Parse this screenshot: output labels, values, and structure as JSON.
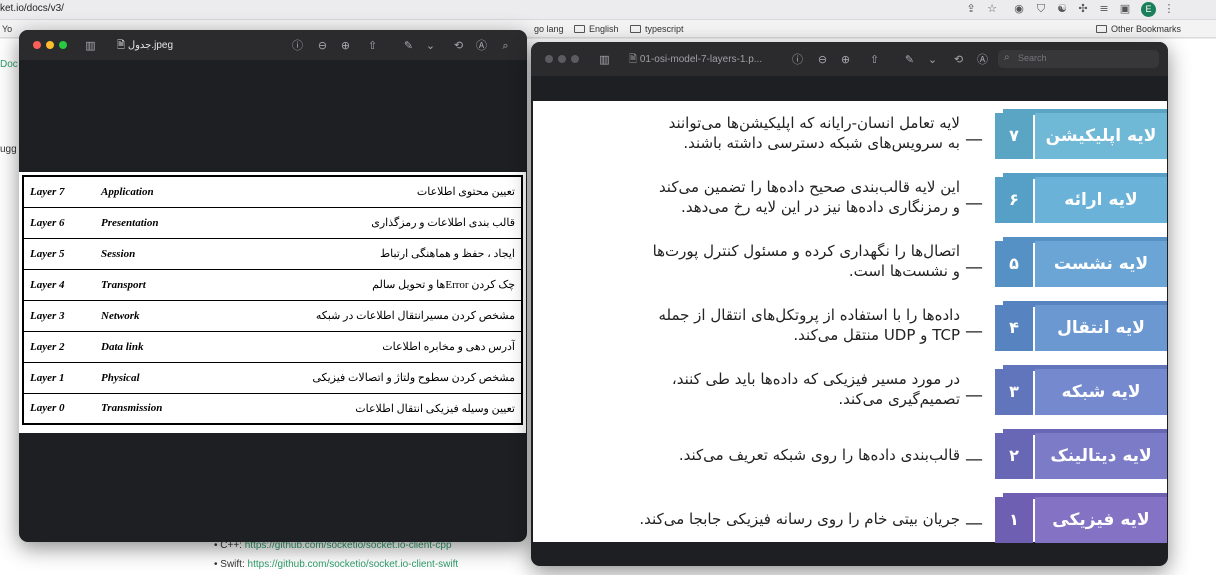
{
  "browser": {
    "url": "ket.io/docs/v3/",
    "avatar": "E"
  },
  "bookmarks": [
    "Yo",
    "go lang",
    "English",
    "typescript",
    "Other Bookmarks"
  ],
  "page": {
    "side_doc": "Doc",
    "side_sug": "ugg",
    "link1_label": "C++:",
    "link1": "https://github.com/socketio/socket.io-client-cpp",
    "link2_label": "Swift:",
    "link2": "https://github.com/socketio/socket.io-client-swift"
  },
  "window_left": {
    "title": "جدول‌.jpeg"
  },
  "window_right": {
    "title": "01-osi-model-7-layers-1.p...",
    "search_placeholder": "Search"
  },
  "table": [
    {
      "layer": "Layer 7",
      "name": "Application",
      "desc": "تعیین محتوی اطلاعات"
    },
    {
      "layer": "Layer 6",
      "name": "Presentation",
      "desc": "قالب بندی اطلاعات و رمزگذاری"
    },
    {
      "layer": "Layer 5",
      "name": "Session",
      "desc": "ایجاد ، حفظ و هماهنگی ارتباط"
    },
    {
      "layer": "Layer 4",
      "name": "Transport",
      "desc": "چک کردن Errorها و تحویل سالم"
    },
    {
      "layer": "Layer 3",
      "name": "Network",
      "desc": "مشخص کردن مسیرانتقال اطلاعات در شبکه"
    },
    {
      "layer": "Layer 2",
      "name": "Data link",
      "desc": "آدرس دهی و مخابره اطلاعات"
    },
    {
      "layer": "Layer 1",
      "name": "Physical",
      "desc": "مشخص کردن سطوح ولتاژ و اتصالات فیزیکی"
    },
    {
      "layer": "Layer 0",
      "name": "Transmission",
      "desc": "تعیین وسیله فیزیکی انتقال اطلاعات"
    }
  ],
  "osi": [
    {
      "num": "۷",
      "name": "لایه اپلیکیشن",
      "line1": "لایه تعامل انسان-رایانه که اپلیکیشن‌ها می‌توانند",
      "line2": "به سرویس‌های شبکه دسترسی داشته باشند.",
      "color": "#6fb8d6",
      "dark": "#5aa4c4"
    },
    {
      "num": "۶",
      "name": "لایه ارائه",
      "line1": "این لایه قالب‌بندی صحیح داده‌ها را تضمین می‌کند",
      "line2": "و رمزنگاری داده‌ها نیز در این لایه رخ می‌دهد.",
      "color": "#6bb2d8",
      "dark": "#569fc6"
    },
    {
      "num": "۵",
      "name": "لایه نشست",
      "line1": "اتصال‌ها را نگهداری کرده و مسئول کنترل پورت‌ها",
      "line2": "و نشست‌ها است.",
      "color": "#6aa5d6",
      "dark": "#5591c4"
    },
    {
      "num": "۴",
      "name": "لایه انتقال",
      "line1": "داده‌ها را با استفاده از پروتکل‌های انتقال از جمله",
      "line2": "TCP و UDP منتقل می‌کند.",
      "color": "#6c98d2",
      "dark": "#5784c0"
    },
    {
      "num": "۳",
      "name": "لایه شبکه",
      "line1": "در مورد مسیر فیزیکی که داده‌ها باید طی کنند،",
      "line2": "تصمیم‌گیری می‌کند.",
      "color": "#7589ce",
      "dark": "#6075bc"
    },
    {
      "num": "۲",
      "name": "لایه دیتالینک",
      "line1": "قالب‌بندی داده‌ها را روی شبکه تعریف می‌کند.",
      "line2": "",
      "color": "#7c7bc8",
      "dark": "#6767b6"
    },
    {
      "num": "۱",
      "name": "لایه فیزیکی",
      "line1": "جریان بیتی خام را روی رسانه فیزیکی جابجا می‌کند.",
      "line2": "",
      "color": "#8473c4",
      "dark": "#6f5fb2"
    }
  ]
}
